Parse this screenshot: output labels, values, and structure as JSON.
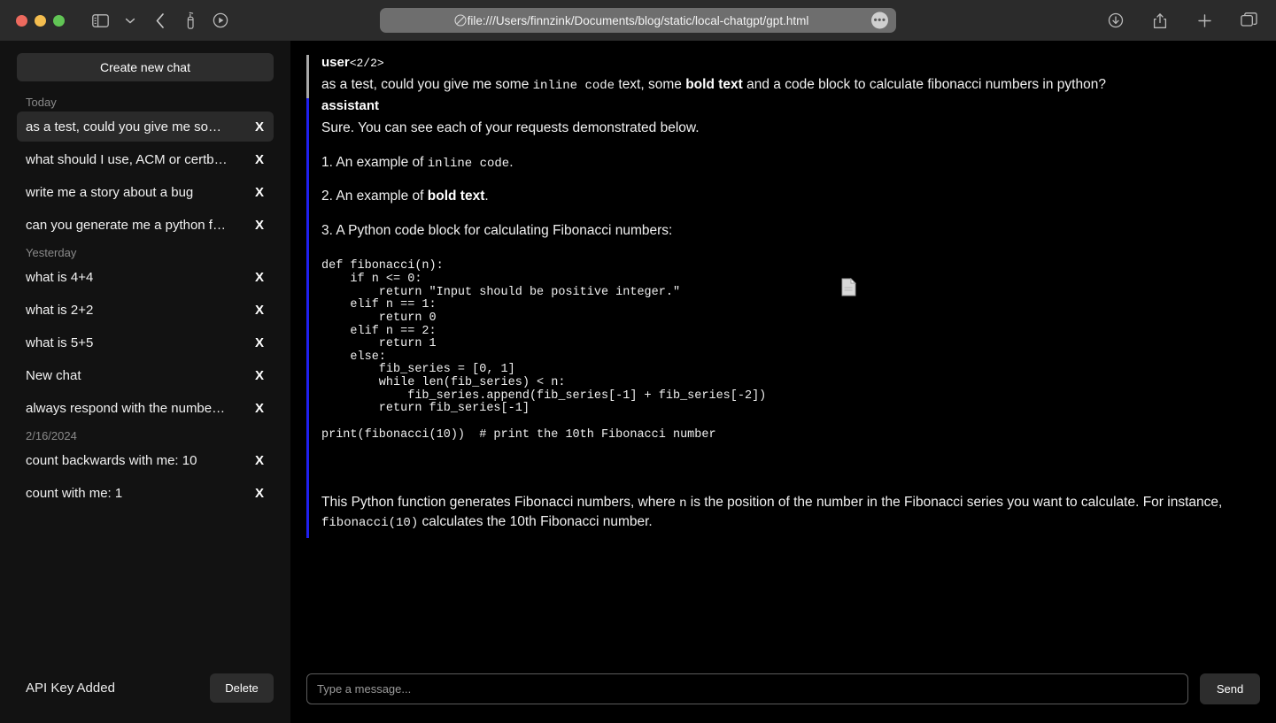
{
  "browser": {
    "url": "file:///Users/finnzink/Documents/blog/static/local-chatgpt/gpt.html",
    "more_label": "•••",
    "icons": {
      "sidebar": "sidebar-toggle-icon",
      "chevron_down": "chevron-down-icon",
      "back": "back-arrow-icon",
      "reader_clean": "spray-bottle-icon",
      "play": "play-circle-icon",
      "download": "download-icon",
      "share": "share-icon",
      "new_tab": "plus-icon",
      "tabs": "tab-overview-icon",
      "shield": "privacy-shield-icon"
    }
  },
  "sidebar": {
    "new_chat_label": "Create new chat",
    "groups": [
      {
        "label": "Today",
        "items": [
          {
            "title": "as a test, could you give me so…",
            "selected": true,
            "close": "X"
          },
          {
            "title": "what should I use, ACM or certb…",
            "selected": false,
            "close": "X"
          },
          {
            "title": "write me a story about a bug",
            "selected": false,
            "close": "X"
          },
          {
            "title": "can you generate me a python f…",
            "selected": false,
            "close": "X"
          }
        ]
      },
      {
        "label": "Yesterday",
        "items": [
          {
            "title": "what is 4+4",
            "selected": false,
            "close": "X"
          },
          {
            "title": "what is 2+2",
            "selected": false,
            "close": "X"
          },
          {
            "title": "what is 5+5",
            "selected": false,
            "close": "X"
          },
          {
            "title": "New chat",
            "selected": false,
            "close": "X"
          },
          {
            "title": "always respond with the numbe…",
            "selected": false,
            "close": "X"
          }
        ]
      },
      {
        "label": "2/16/2024",
        "items": [
          {
            "title": "count backwards with me: 10",
            "selected": false,
            "close": "X"
          },
          {
            "title": "count with me: 1",
            "selected": false,
            "close": "X"
          }
        ]
      }
    ],
    "footer": {
      "api_status": "API Key Added",
      "delete_label": "Delete"
    }
  },
  "chat": {
    "user": {
      "role": "user",
      "counter": "<2/2>",
      "text_part1": "as a test, could you give me some ",
      "code1": "inline code",
      "text_part2": " text, some ",
      "bold1": "bold text",
      "text_part3": " and a code block to calculate fibonacci numbers in python?"
    },
    "assistant": {
      "role": "assistant",
      "intro": "Sure. You can see each of your requests demonstrated below.",
      "item1_pre": "1. An example of ",
      "item1_code": "inline code",
      "item1_post": ".",
      "item2_pre": "2. An example of ",
      "item2_bold": "bold text",
      "item2_post": ".",
      "item3": "3. A Python code block for calculating Fibonacci numbers:",
      "code": "def fibonacci(n):\n    if n <= 0:\n        return \"Input should be positive integer.\"\n    elif n == 1:\n        return 0\n    elif n == 2:\n        return 1\n    else:\n        fib_series = [0, 1]\n        while len(fib_series) < n:\n            fib_series.append(fib_series[-1] + fib_series[-2])\n        return fib_series[-1]\n\nprint(fibonacci(10))  # print the 10th Fibonacci number",
      "outro_pre": "This Python function generates Fibonacci numbers, where ",
      "outro_code1": "n",
      "outro_mid": " is the position of the number in the Fibonacci series you want to calculate. For instance, ",
      "outro_code2": "fibonacci(10)",
      "outro_post": " calculates the 10th Fibonacci number."
    }
  },
  "composer": {
    "input_value": "",
    "placeholder": "Type a message...",
    "send_label": "Send"
  },
  "colors": {
    "accent_assistant": "#2020ee",
    "accent_user": "#a8a8a8",
    "sidebar_bg": "#121212",
    "main_bg": "#000000",
    "selected_item": "#2a2a2a"
  }
}
